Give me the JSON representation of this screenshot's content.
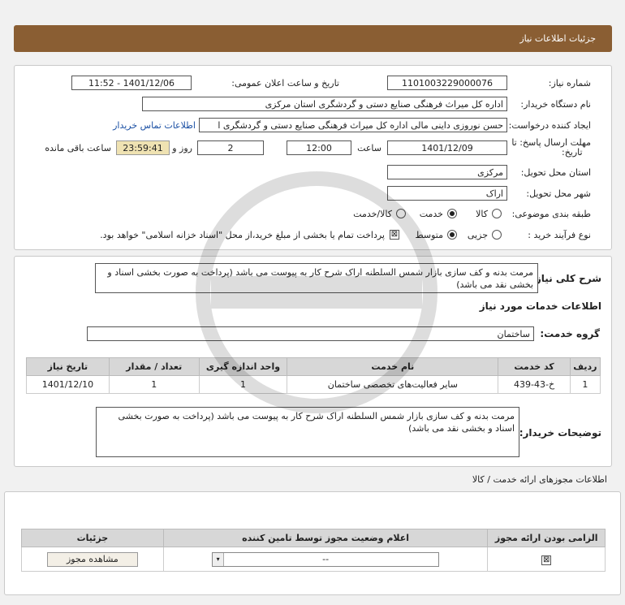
{
  "header": {
    "title": "جزئیات اطلاعات نیاز"
  },
  "form": {
    "need_number_label": "شماره نیاز:",
    "need_number": "1101003229000076",
    "announce_label": "تاریخ و ساعت اعلان عمومی:",
    "announce_value": "1401/12/06 - 11:52",
    "buyer_org_label": "نام دستگاه خریدار:",
    "buyer_org": "اداره کل میراث فرهنگی  صنایع دستی و گردشگری استان مرکزی",
    "creator_label": "ایجاد کننده درخواست:",
    "creator": "حسن نوروزی داینی مالی  اداره کل میراث فرهنگی  صنایع دستی و گردشگری ا",
    "contact_link": "اطلاعات تماس خریدار",
    "deadline_label_1": "مهلت ارسال پاسخ: تا",
    "deadline_label_2": "تاریخ:",
    "deadline_date": "1401/12/09",
    "time_label": "ساعت",
    "deadline_time": "12:00",
    "days_label": "روز و",
    "days": "2",
    "remaining_time": "23:59:41",
    "remaining_label": "ساعت باقی مانده",
    "province_label": "استان محل تحویل:",
    "province": "مرکزی",
    "city_label": "شهر محل تحویل:",
    "city": "اراک",
    "category_label": "طبقه بندی موضوعی:",
    "category_options": [
      "کالا",
      "خدمت",
      "کالا/خدمت"
    ],
    "process_label": "نوع فرآیند خرید :",
    "process_options": [
      "جزیی",
      "متوسط"
    ],
    "payment_note": "پرداخت تمام یا بخشی از مبلغ خرید،از محل \"اسناد خزانه اسلامی\" خواهد بود."
  },
  "summary": {
    "label": "شرح کلی نیاز:",
    "text": "مرمت بدنه و کف سازی بازار شمس السلطنه اراک شرح کار به پیوست  می باشد  (پرداخت به صورت بخشی اسناد و بخشی نقد می باشد)",
    "services_heading": "اطلاعات خدمات مورد نیاز",
    "service_group_label": "گروه خدمت:",
    "service_group": "ساختمان"
  },
  "table": {
    "headers": [
      "ردیف",
      "کد خدمت",
      "نام خدمت",
      "واحد اندازه گیری",
      "تعداد / مقدار",
      "تاریخ نیاز"
    ],
    "rows": [
      [
        "1",
        "خ-43-439",
        "سایر فعالیت‌های تخصصی ساختمان",
        "1",
        "1",
        "1401/12/10"
      ]
    ]
  },
  "buyer_notes": {
    "label": "توضیحات خریدار:",
    "text": "مرمت بدنه و کف سازی بازار شمس السلطنه اراک شرح کار به پیوست  می باشد  (پرداخت به صورت بخشی اسناد و بخشی نقد می باشد)"
  },
  "permits": {
    "heading": "اطلاعات مجوزهای ارائه خدمت / کالا",
    "headers": [
      "الزامی بودن ارائه مجوز",
      "اعلام وضعیت مجوز توسط تامین کننده",
      "جزئیات"
    ],
    "select_value": "--",
    "view_button": "مشاهده مجوز"
  }
}
